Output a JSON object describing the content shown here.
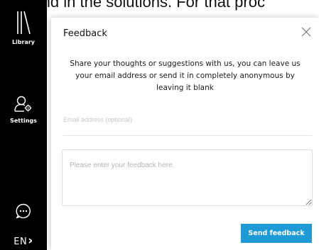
{
  "background": {
    "text": "may find in the solutions. For that proc"
  },
  "sidebar": {
    "library_label": "Library",
    "settings_label": "Settings",
    "language": "EN",
    "language_chevron": "›"
  },
  "dialog": {
    "title": "Feedback",
    "description": "Share your thoughts or suggestions with us, you can leave us your email address or send it in completely anonymous by leaving it blank",
    "email_placeholder": "Email address (optional)",
    "email_value": "",
    "feedback_placeholder": "Please enter your feedback here.",
    "feedback_value": "",
    "send_label": "Send feedback"
  },
  "colors": {
    "sidebar_bg": "#000000",
    "accent": "#1e9ad6"
  },
  "icons": {
    "library": "library-icon",
    "settings": "settings-icon",
    "chat": "chat-icon",
    "close": "close-icon"
  }
}
